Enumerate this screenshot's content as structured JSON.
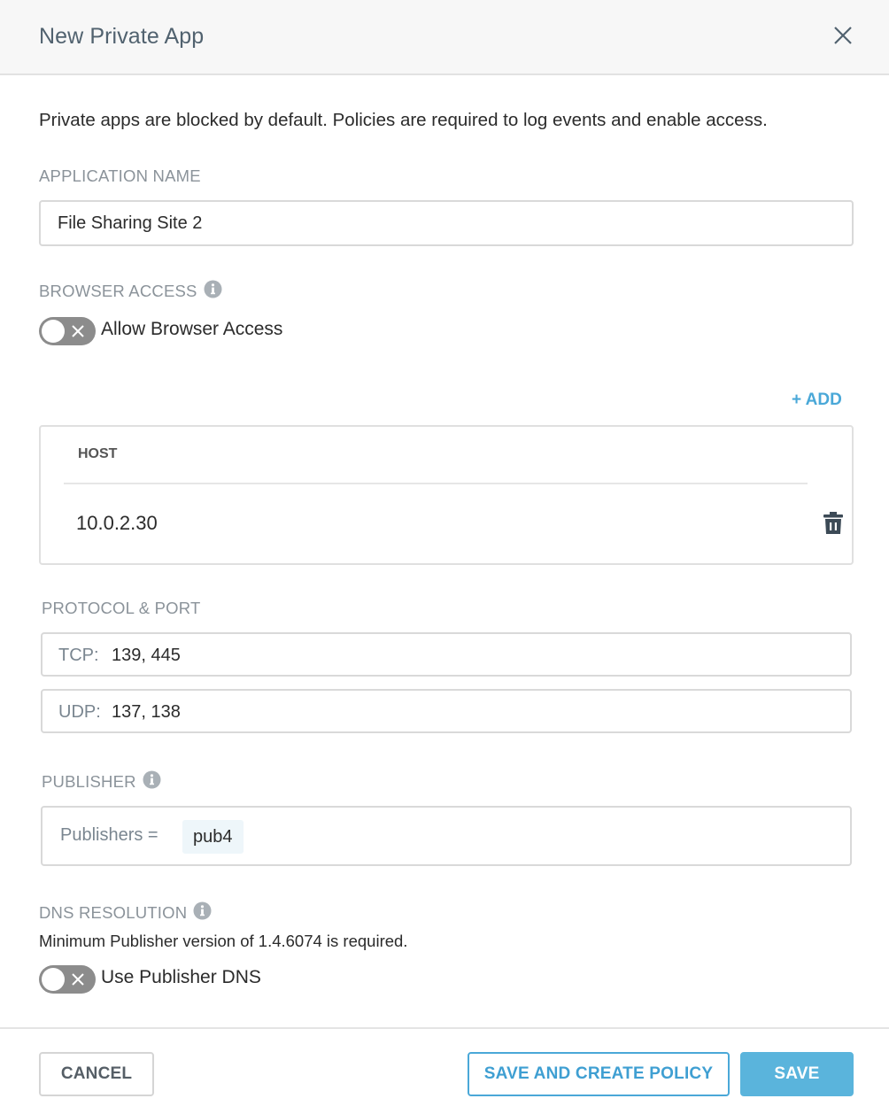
{
  "dialog": {
    "title": "New Private App"
  },
  "intro_text": "Private apps are blocked by default. Policies are required to log events and enable access.",
  "application_name": {
    "label": "APPLICATION NAME",
    "value": "File Sharing Site 2"
  },
  "browser_access": {
    "label": "BROWSER ACCESS",
    "toggle_label": "Allow Browser Access",
    "enabled": false
  },
  "hosts": {
    "add_label": "+ ADD",
    "column_header": "HOST",
    "rows": [
      "10.0.2.30"
    ]
  },
  "protocol_port": {
    "label": "PROTOCOL & PORT",
    "tcp_key": "TCP:",
    "tcp_value": "139, 445",
    "udp_key": "UDP:",
    "udp_value": "137, 138"
  },
  "publisher": {
    "label": "PUBLISHER",
    "key": "Publishers =",
    "chip": "pub4"
  },
  "dns_resolution": {
    "label": "DNS RESOLUTION",
    "note": "Minimum Publisher version of 1.4.6074 is required.",
    "toggle_label": "Use Publisher DNS",
    "enabled": false
  },
  "footer": {
    "cancel_label": "CANCEL",
    "save_policy_label": "SAVE AND CREATE POLICY",
    "save_label": "SAVE"
  },
  "colors": {
    "accent": "#4aa8d8",
    "save_button": "#5ab4dc",
    "toggle_off": "#8c8c8c"
  }
}
